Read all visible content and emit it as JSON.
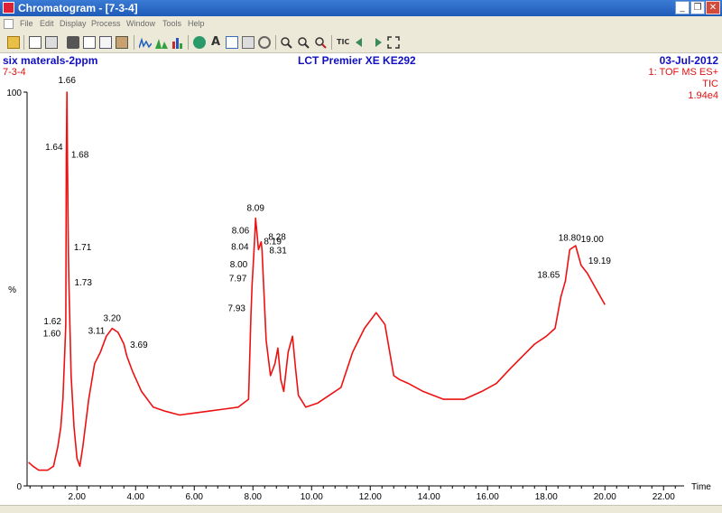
{
  "window": {
    "title": "Chromatogram - [7-3-4]",
    "min_label": "_",
    "restore_label": "❐",
    "close_label": "✕"
  },
  "menu": [
    "File",
    "Edit",
    "Display",
    "Process",
    "Window",
    "Tools",
    "Help"
  ],
  "toolbar": {
    "tic_label": "TIC",
    "icons": [
      "open-icon",
      "print-preview-icon",
      "print-icon",
      "camera-icon",
      "copy-icon",
      "copy-list-icon",
      "paste-icon",
      "chromatogram-icon",
      "peaks-icon",
      "bar-chart-icon",
      "globe-icon",
      "text-icon",
      "layout-icon",
      "link-icon",
      "timer-icon",
      "zoom-in-icon",
      "zoom-out-icon",
      "zoom-fit-icon",
      "tic-icon",
      "arrow-left-icon",
      "arrow-right-icon",
      "fullscreen-icon"
    ]
  },
  "header": {
    "sample": "six materals-2ppm",
    "instrument": "LCT Premier XE KE292",
    "date": "03-Jul-2012",
    "file": "7-3-4",
    "scan": "1: TOF MS ES+",
    "trace": "TIC",
    "intensity": "1.94e4"
  },
  "colors": {
    "trace": "#ee1111",
    "axis": "#000000",
    "header_blue": "#1010c0"
  },
  "chart_data": {
    "type": "line",
    "xlabel": "Time",
    "ylabel": "%",
    "xlim": [
      0.3,
      22.7
    ],
    "ylim": [
      0,
      100
    ],
    "xticks": [
      "2.00",
      "4.00",
      "6.00",
      "8.00",
      "10.00",
      "12.00",
      "14.00",
      "16.00",
      "18.00",
      "20.00",
      "22.00"
    ],
    "yticks": [
      "0",
      "100"
    ],
    "grid": false,
    "series": [
      {
        "x": [
          0.35,
          0.5,
          0.7,
          1.0,
          1.2,
          1.35,
          1.45,
          1.52,
          1.58,
          1.62,
          1.64,
          1.66,
          1.68,
          1.71,
          1.73,
          1.8,
          1.9,
          2.0,
          2.1,
          2.2,
          2.4,
          2.6,
          2.8,
          3.0,
          3.2,
          3.4,
          3.6,
          3.7,
          3.9,
          4.2,
          4.6,
          5.0,
          5.5,
          6.0,
          6.5,
          7.0,
          7.5,
          7.85,
          7.93,
          7.97,
          8.0,
          8.04,
          8.06,
          8.09,
          8.19,
          8.28,
          8.31,
          8.45,
          8.6,
          8.75,
          8.85,
          8.95,
          9.05,
          9.2,
          9.35,
          9.45,
          9.55,
          9.8,
          10.2,
          10.6,
          11.0,
          11.4,
          11.8,
          12.2,
          12.5,
          12.8,
          13.0,
          13.3,
          13.8,
          14.5,
          15.2,
          15.8,
          16.3,
          16.8,
          17.2,
          17.6,
          18.0,
          18.3,
          18.5,
          18.65,
          18.8,
          19.0,
          19.19,
          19.4,
          19.7,
          20.0
        ],
        "y": [
          6,
          5,
          4,
          4,
          5,
          10,
          15,
          22,
          33,
          41,
          84,
          100,
          82,
          59,
          50,
          28,
          15,
          7,
          5,
          10,
          22,
          31,
          34,
          38,
          40,
          39,
          36,
          33,
          29,
          24,
          20,
          19,
          18,
          18.5,
          19,
          19.5,
          20,
          22,
          43,
          51,
          55,
          60,
          63,
          68,
          60,
          62,
          60,
          37,
          28,
          31,
          35,
          27,
          24,
          34,
          38,
          30,
          23,
          20,
          21,
          23,
          25,
          34,
          40,
          44,
          41,
          28,
          27,
          26,
          24,
          22,
          22,
          24,
          26,
          30,
          33,
          36,
          38,
          40,
          48,
          52,
          60,
          61,
          56,
          54,
          50,
          46
        ]
      }
    ],
    "peak_labels": [
      {
        "text": "1.66",
        "x": 1.66
      },
      {
        "text": "1.64",
        "x": 1.64
      },
      {
        "text": "1.68",
        "x": 1.68
      },
      {
        "text": "1.71",
        "x": 1.71
      },
      {
        "text": "1.73",
        "x": 1.73
      },
      {
        "text": "1.62",
        "x": 1.62
      },
      {
        "text": "1.60",
        "x": 1.6
      },
      {
        "text": "3.20",
        "x": 3.2
      },
      {
        "text": "3.69",
        "x": 3.69
      },
      {
        "text": "3.11",
        "x": 3.11
      },
      {
        "text": "8.09",
        "x": 8.09
      },
      {
        "text": "8.06",
        "x": 8.06
      },
      {
        "text": "8.19",
        "x": 8.19
      },
      {
        "text": "8.04",
        "x": 8.04
      },
      {
        "text": "8.28",
        "x": 8.28
      },
      {
        "text": "8.31",
        "x": 8.31
      },
      {
        "text": "8.00",
        "x": 8.0
      },
      {
        "text": "7.97",
        "x": 7.97
      },
      {
        "text": "7.93",
        "x": 7.93
      },
      {
        "text": "18.80",
        "x": 18.8
      },
      {
        "text": "18.65",
        "x": 18.65
      },
      {
        "text": "19.00",
        "x": 19.0
      },
      {
        "text": "19.19",
        "x": 19.19
      }
    ]
  }
}
